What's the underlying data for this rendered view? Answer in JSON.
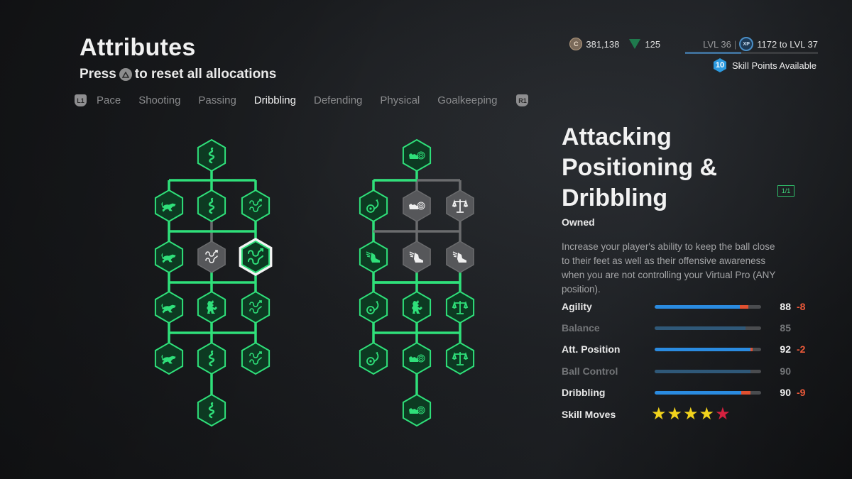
{
  "header": {
    "title": "Attributes",
    "subtitle_pre": "Press",
    "subtitle_post": "to reset all allocations",
    "reset_button_icon": "triangle-button-icon"
  },
  "tabs": {
    "left_shoulder": "L1",
    "right_shoulder": "R1",
    "items": [
      {
        "label": "Pace",
        "active": false
      },
      {
        "label": "Shooting",
        "active": false
      },
      {
        "label": "Passing",
        "active": false
      },
      {
        "label": "Dribbling",
        "active": true
      },
      {
        "label": "Defending",
        "active": false
      },
      {
        "label": "Physical",
        "active": false
      },
      {
        "label": "Goalkeeping",
        "active": false
      }
    ]
  },
  "hud": {
    "coins": "381,138",
    "points": "125",
    "level": "LVL 36",
    "separator": "|",
    "xp_to_next": "1172 to LVL 37",
    "xp_progress": 0.42,
    "skill_points_count": "10",
    "skill_points_label": "Skill Points Available"
  },
  "colors": {
    "owned_green": "#2fe07a",
    "locked_gray": "#6b6c6e",
    "stat_blue": "#2a8be0",
    "penalty_red": "#e05030",
    "star_yellow": "#f2d31c",
    "star_red": "#d6213f"
  },
  "tree_left": {
    "nodes": [
      {
        "icon": "snake",
        "state": "owned"
      },
      {
        "icon": "cheetah",
        "state": "owned"
      },
      {
        "icon": "snake",
        "state": "owned"
      },
      {
        "icon": "dribble-path",
        "state": "owned"
      },
      {
        "icon": "cheetah",
        "state": "owned"
      },
      {
        "icon": "dribble-path",
        "state": "locked"
      },
      {
        "icon": "dribble-path",
        "state": "selected"
      },
      {
        "icon": "cheetah",
        "state": "owned"
      },
      {
        "icon": "lion",
        "state": "owned"
      },
      {
        "icon": "dribble-path",
        "state": "owned"
      },
      {
        "icon": "cheetah",
        "state": "owned"
      },
      {
        "icon": "snake",
        "state": "owned"
      },
      {
        "icon": "dribble-path",
        "state": "owned"
      },
      {
        "icon": "snake",
        "state": "owned"
      }
    ]
  },
  "tree_right": {
    "nodes": [
      {
        "icon": "boot-target",
        "state": "owned"
      },
      {
        "icon": "ball-curve",
        "state": "owned"
      },
      {
        "icon": "boot-target",
        "state": "locked"
      },
      {
        "icon": "scales",
        "state": "locked"
      },
      {
        "icon": "winged-boot",
        "state": "owned"
      },
      {
        "icon": "winged-boot",
        "state": "locked"
      },
      {
        "icon": "winged-boot",
        "state": "locked"
      },
      {
        "icon": "ball-curve",
        "state": "owned"
      },
      {
        "icon": "lion",
        "state": "owned"
      },
      {
        "icon": "scales",
        "state": "owned"
      },
      {
        "icon": "ball-curve",
        "state": "owned"
      },
      {
        "icon": "boot-target",
        "state": "owned"
      },
      {
        "icon": "scales",
        "state": "owned"
      },
      {
        "icon": "boot-target",
        "state": "owned"
      }
    ]
  },
  "detail": {
    "title_lines": [
      "Attacking",
      "Positioning &",
      "Dribbling"
    ],
    "count_badge": "1/1",
    "status": "Owned",
    "description": "Increase your player's ability to keep the ball close to their feet as well as their offensive awareness when you are not controlling your Virtual Pro (ANY position).",
    "stats": [
      {
        "label": "Agility",
        "value": "88",
        "delta": "-8",
        "base": 80,
        "dim": false
      },
      {
        "label": "Balance",
        "value": "85",
        "delta": "",
        "base": 85,
        "dim": true
      },
      {
        "label": "Att. Position",
        "value": "92",
        "delta": "-2",
        "base": 90,
        "dim": false
      },
      {
        "label": "Ball Control",
        "value": "90",
        "delta": "",
        "base": 90,
        "dim": true
      },
      {
        "label": "Dribbling",
        "value": "90",
        "delta": "-9",
        "base": 81,
        "dim": false
      }
    ],
    "skill_moves_label": "Skill Moves",
    "skill_moves_stars": 5,
    "skill_moves_rating": 4,
    "skill_moves_penalty": 1
  }
}
